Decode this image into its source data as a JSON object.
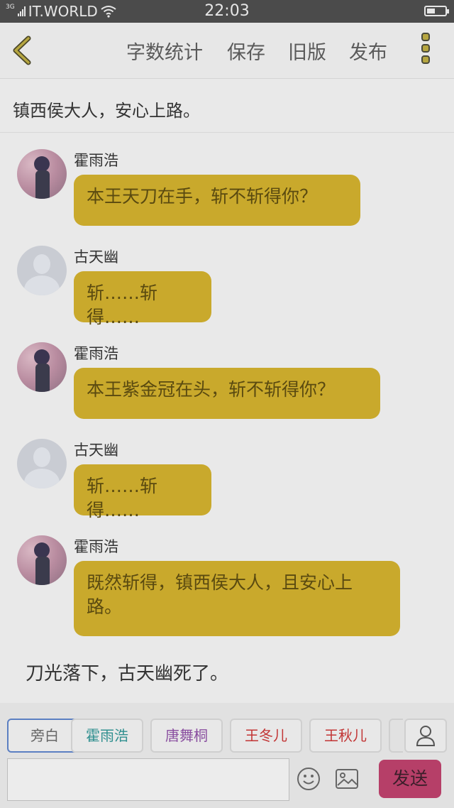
{
  "status_bar": {
    "carrier": "IT.WORLD",
    "network": "3G",
    "time": "22:03"
  },
  "header": {
    "actions": [
      "字数统计",
      "保存",
      "旧版",
      "发布"
    ]
  },
  "narration_top": "镇西侯大人，安心上路。",
  "messages": [
    {
      "sender": "霍雨浩",
      "text": "本王天刀在手，斩不斩得你？"
    },
    {
      "sender": "古天幽",
      "text": "斩……斩得……"
    },
    {
      "sender": "霍雨浩",
      "text": "本王紫金冠在头，斩不斩得你？"
    },
    {
      "sender": "古天幽",
      "text": "斩……斩得……"
    },
    {
      "sender": "霍雨浩",
      "text": "既然斩得，镇西侯大人，且安心上路。"
    }
  ],
  "narration_bottom": "刀光落下，古天幽死了。",
  "characters": [
    {
      "label": "旁白",
      "color": "#666666",
      "selected": true
    },
    {
      "label": "霍雨浩",
      "color": "#2f8f8f"
    },
    {
      "label": "唐舞桐",
      "color": "#8a4fa0"
    },
    {
      "label": "王冬儿",
      "color": "#c23535"
    },
    {
      "label": "王秋儿",
      "color": "#c23535"
    }
  ],
  "composer": {
    "send_label": "发送",
    "input_value": ""
  },
  "colors": {
    "bubble": "#c9a92c",
    "send_button": "#b63f68",
    "accent": "#b6a640"
  }
}
